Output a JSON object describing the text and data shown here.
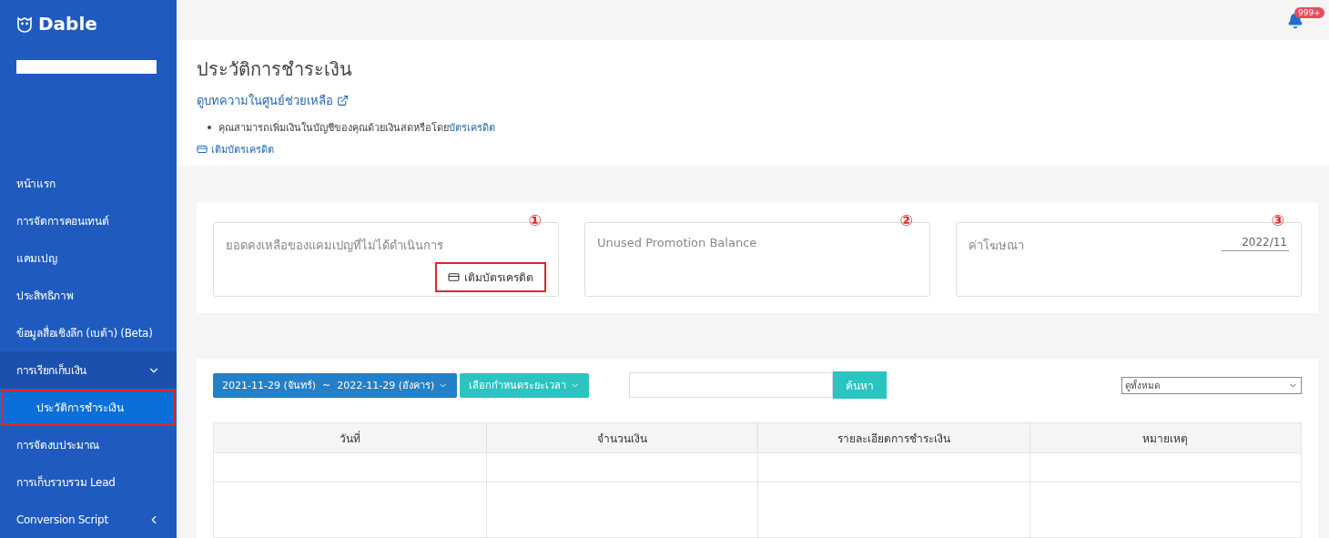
{
  "sidebar": {
    "logo": "Dable",
    "items": [
      {
        "label": "หน้าแรก",
        "selected": false
      },
      {
        "label": "การจัดการคอนเทนต์",
        "selected": false
      },
      {
        "label": "แคมเปญ",
        "selected": false
      },
      {
        "label": "ประสิทธิภาพ",
        "selected": false
      },
      {
        "label": "ข้อมูลสื่อเชิงลึก (เบต้า) (Beta)",
        "selected": false
      },
      {
        "label": "การเรียกเก็บเงิน",
        "selected": false,
        "expanded": true,
        "children": [
          {
            "label": "ประวัติการชำระเงิน",
            "selected": true,
            "highlighted": true
          }
        ]
      },
      {
        "label": "การจัดงบประมาณ",
        "selected": false
      },
      {
        "label": "การเก็บรวบรวม Lead",
        "selected": false
      },
      {
        "label": "Conversion Script",
        "selected": false,
        "expanded": false
      }
    ]
  },
  "header": {
    "badge": "999+"
  },
  "page": {
    "title": "ประวัติการชำระเงิน",
    "help_link": "ดูบทความในศูนย์ช่วยเหลือ",
    "note": "คุณสามารถเพิ่มเงินในบัญชีของคุณด้วยเงินสดหรือโดย",
    "note_link": "บัตรเครดิต",
    "topup_link": "เติมบัตรเครดิต"
  },
  "cards": [
    {
      "kind": "topup",
      "marker": "①",
      "title": "ยอดคงเหลือของแคมเปญที่ไม่ได้ดำเนินการ",
      "button": "เติมบัตรเครดิต",
      "highlighted": true
    },
    {
      "kind": "plain",
      "marker": "②",
      "title": "Unused Promotion Balance"
    },
    {
      "kind": "month",
      "marker": "③",
      "title": "ค่าโฆษณา",
      "value": "2022/11"
    }
  ],
  "toolbar": {
    "date_range": "2021-11-29 (จันทร์)  ~  2022-11-29 (อังคาร)",
    "period_button": "เลือกกำหนดระยะเวลา",
    "search_button": "ค้นหา",
    "filter": "ดูทั้งหมด"
  },
  "table": {
    "columns": [
      "วันที่",
      "จำนวนเงิน",
      "รายละเอียดการชำระเงิน",
      "หมายเหตุ"
    ]
  }
}
